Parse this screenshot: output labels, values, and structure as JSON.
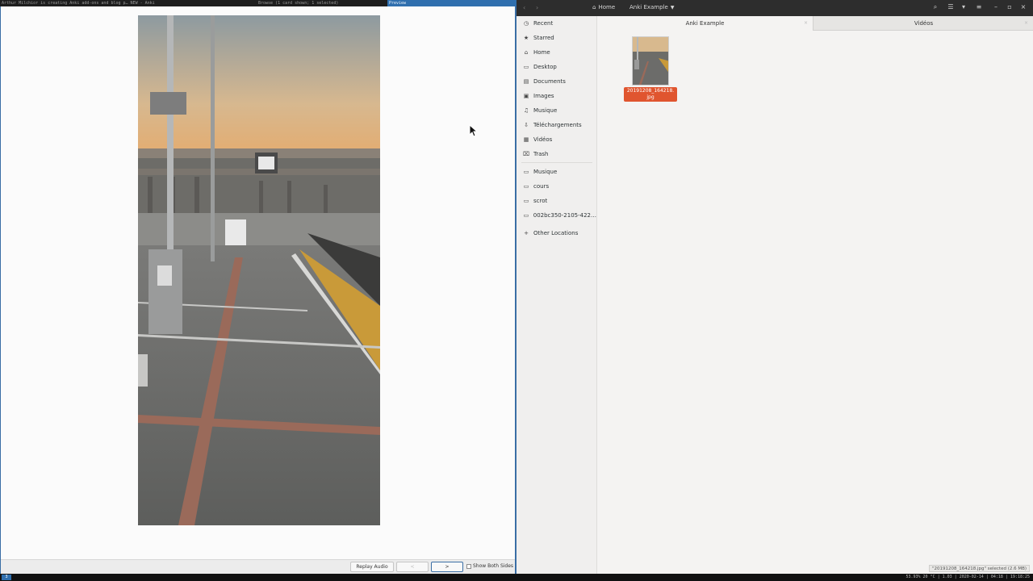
{
  "wm": {
    "title_left": "Arthur Milchior is creating Anki add-ons and blog p… NEW - Anki",
    "title_browse": "Browse (1 card shown; 1 selected)",
    "title_preview": "Preview"
  },
  "anki": {
    "replay_label": "Replay Audio",
    "prev_label": "<",
    "next_label": ">",
    "show_both_label": "Show Both Sides",
    "card_image_name": "station-platform-sunset-photo"
  },
  "files": {
    "breadcrumb_home": "Home",
    "breadcrumb_current": "Anki Example",
    "tabs": [
      {
        "label": "Anki Example",
        "active": true
      },
      {
        "label": "Vidéos",
        "active": false
      }
    ],
    "sidebar": [
      {
        "label": "Recent",
        "icon": "clock-icon"
      },
      {
        "label": "Starred",
        "icon": "star-icon"
      },
      {
        "label": "Home",
        "icon": "home-icon"
      },
      {
        "label": "Desktop",
        "icon": "desktop-icon"
      },
      {
        "label": "Documents",
        "icon": "document-icon"
      },
      {
        "label": "Images",
        "icon": "image-icon"
      },
      {
        "label": "Musique",
        "icon": "music-icon"
      },
      {
        "label": "Téléchargements",
        "icon": "download-icon"
      },
      {
        "label": "Vidéos",
        "icon": "video-icon"
      },
      {
        "label": "Trash",
        "icon": "trash-icon"
      },
      {
        "label": "Musique",
        "icon": "folder-icon"
      },
      {
        "label": "cours",
        "icon": "folder-icon"
      },
      {
        "label": "scrot",
        "icon": "folder-icon"
      },
      {
        "label": "002bc350-2105-422…",
        "icon": "drive-icon"
      },
      {
        "label": "Other Locations",
        "icon": "plus-icon"
      }
    ],
    "file": {
      "name_line1": "20191208_164218.",
      "name_line2": "jpg"
    },
    "status": "\"20191208_164218.jpg\" selected (2.6 MB)",
    "accent": "#e0552f"
  },
  "sysbar": {
    "workspace": "3",
    "stats": "53.93% 20 °C | 1.03 | 2020-02-14 | 04:18 | 19:18:25"
  }
}
